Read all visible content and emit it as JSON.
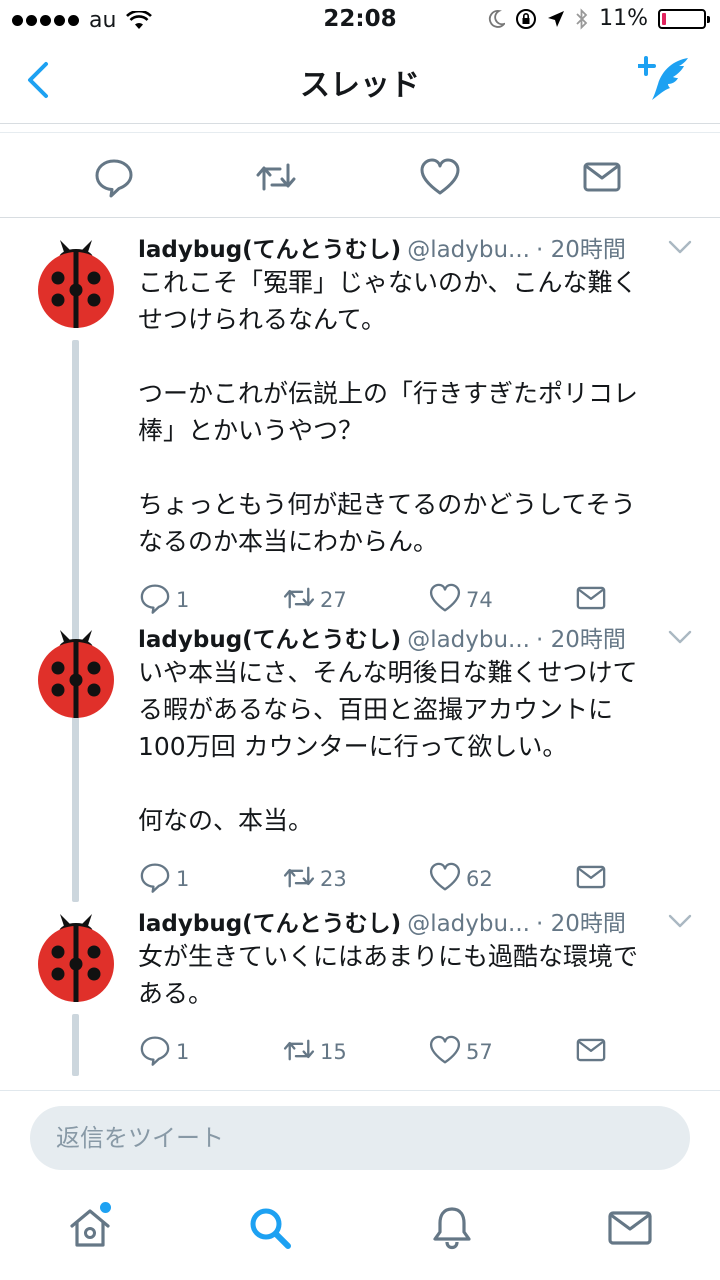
{
  "status_bar": {
    "carrier": "au",
    "time": "22:08",
    "battery": "11%",
    "battery_level": 0.11
  },
  "nav": {
    "title": "スレッド",
    "icons": [
      "back-chevron-icon",
      "compose-tweet-icon"
    ]
  },
  "top_actions": [
    "reply-icon",
    "retweet-icon",
    "like-icon",
    "dm-icon"
  ],
  "tweets": [
    {
      "name": "ladybug(てんとうむし)",
      "handle": "@ladybu...",
      "time": "· 20時間",
      "lines": [
        "これこそ「冤罪」じゃないのか、こんな難く",
        "せつけられるなんて。",
        "",
        "つーかこれが伝説上の「行きすぎたポリコレ",
        "棒」とかいうやつ？",
        "",
        "ちょっともう何が起きてるのかどうしてそう",
        "なるのか本当にわからん。"
      ],
      "replies": "1",
      "retweets": "27",
      "likes": "74"
    },
    {
      "name": "ladybug(てんとうむし)",
      "handle": "@ladybu...",
      "time": "· 20時間",
      "lines": [
        "いや本当にさ、そんな明後日な難くせつけて",
        "る暇があるなら、百田と盗撮アカウントに",
        "100万回 カウンターに行って欲しい。",
        "",
        "何なの、本当。"
      ],
      "replies": "1",
      "retweets": "23",
      "likes": "62"
    },
    {
      "name": "ladybug(てんとうむし)",
      "handle": "@ladybu...",
      "time": "· 20時間",
      "lines": [
        "女が生きていくにはあまりにも過酷な環境で",
        "ある。"
      ],
      "replies": "1",
      "retweets": "15",
      "likes": "57"
    }
  ],
  "reply": {
    "placeholder": "返信をツイート"
  },
  "tabs": [
    "home-icon",
    "search-icon",
    "notifications-icon",
    "messages-icon"
  ],
  "colors": {
    "accent": "#1da1f2",
    "muted": "#657786",
    "ladybug_red": "#e0302a"
  }
}
